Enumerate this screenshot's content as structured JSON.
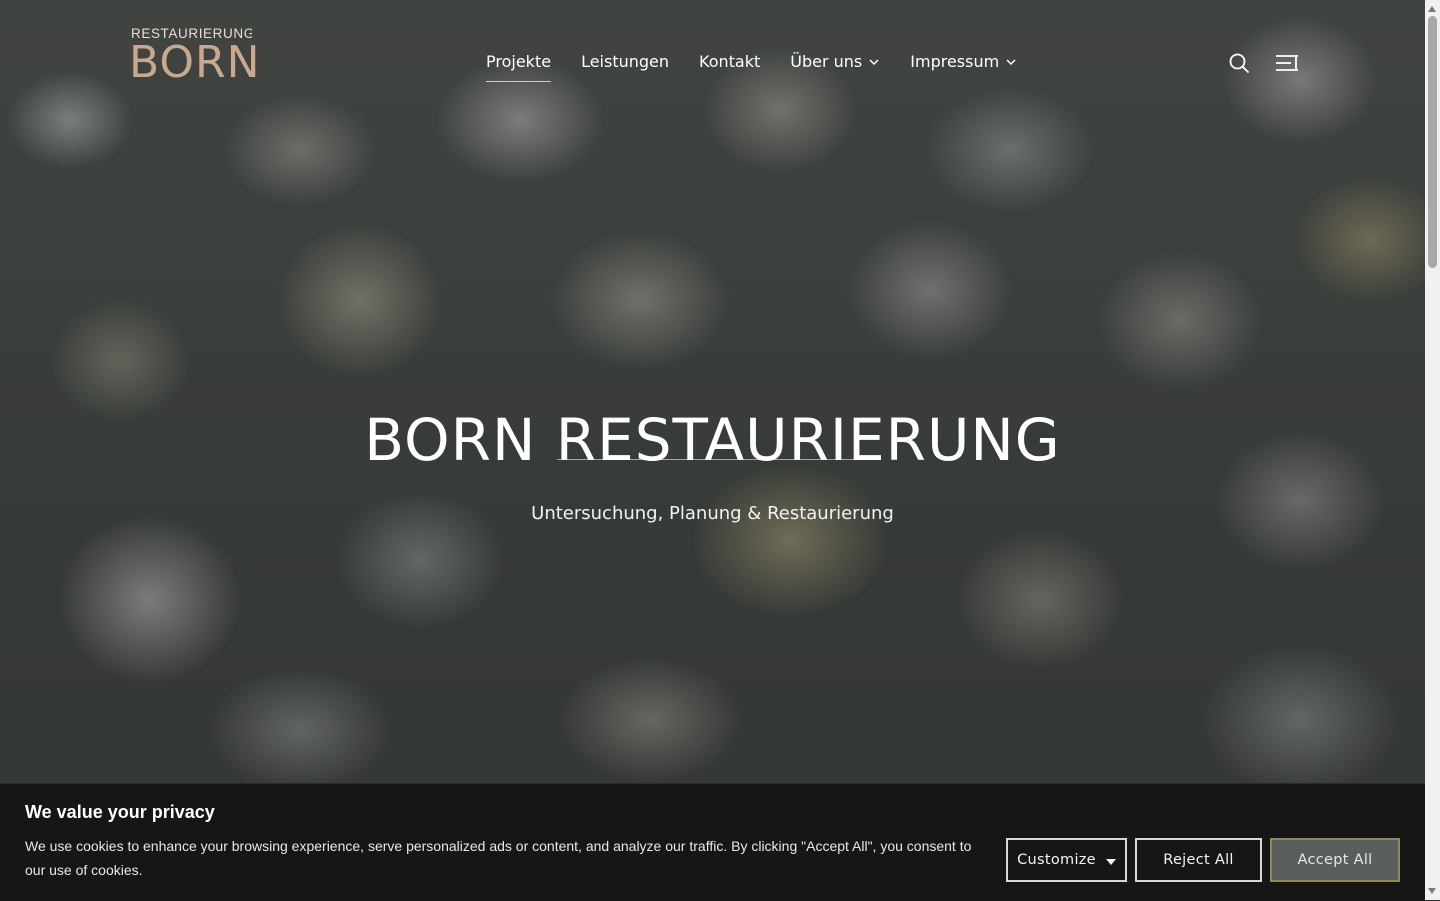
{
  "brand": {
    "logo_top": "RESTAURIERUNG",
    "logo_main": "BORN"
  },
  "nav": {
    "items": [
      {
        "label": "Projekte",
        "active": true,
        "dropdown": false
      },
      {
        "label": "Leistungen",
        "active": false,
        "dropdown": false
      },
      {
        "label": "Kontakt",
        "active": false,
        "dropdown": false
      },
      {
        "label": "Über uns",
        "active": false,
        "dropdown": true
      },
      {
        "label": "Impressum",
        "active": false,
        "dropdown": true
      }
    ],
    "icons": [
      "search-icon",
      "menu-icon"
    ]
  },
  "hero": {
    "title": "BORN RESTAURIERUNG",
    "subtitle": "Untersuchung, Planung & Restaurierung"
  },
  "cookie_banner": {
    "title": "We value your privacy",
    "text": "We use cookies to enhance your browsing experience, serve personalized ads or content, and analyze our traffic. By clicking \"Accept All\", you consent to our use of cookies.",
    "customize_label": "Customize",
    "reject_label": "Reject All",
    "accept_label": "Accept All"
  },
  "colors": {
    "logo_accent": "#c9a98b",
    "banner_bg": "#161616",
    "accept_bg": "#5a5f5c"
  }
}
